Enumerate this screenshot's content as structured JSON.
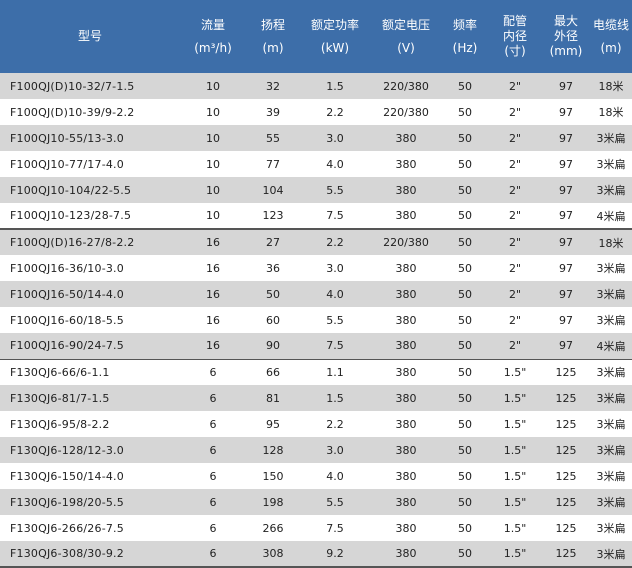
{
  "headers": [
    {
      "lines": [
        "型号"
      ],
      "unit": ""
    },
    {
      "lines": [
        "流量"
      ],
      "unit": "(m³/h)"
    },
    {
      "lines": [
        "扬程"
      ],
      "unit": "(m)"
    },
    {
      "lines": [
        "额定功率"
      ],
      "unit": "(kW)"
    },
    {
      "lines": [
        "额定电压"
      ],
      "unit": "(V)"
    },
    {
      "lines": [
        "频率"
      ],
      "unit": "(Hz)"
    },
    {
      "lines": [
        "配管",
        "内径",
        "(寸)"
      ],
      "unit": ""
    },
    {
      "lines": [
        "最大",
        "外径",
        "(mm)"
      ],
      "unit": ""
    },
    {
      "lines": [
        "电缆线"
      ],
      "unit": "(m)"
    }
  ],
  "rows": [
    [
      "F100QJ(D)10-32/7-1.5",
      "10",
      "32",
      "1.5",
      "220/380",
      "50",
      "2\"",
      "97",
      "18米"
    ],
    [
      "F100QJ(D)10-39/9-2.2",
      "10",
      "39",
      "2.2",
      "220/380",
      "50",
      "2\"",
      "97",
      "18米"
    ],
    [
      "F100QJ10-55/13-3.0",
      "10",
      "55",
      "3.0",
      "380",
      "50",
      "2\"",
      "97",
      "3米扁"
    ],
    [
      "F100QJ10-77/17-4.0",
      "10",
      "77",
      "4.0",
      "380",
      "50",
      "2\"",
      "97",
      "3米扁"
    ],
    [
      "F100QJ10-104/22-5.5",
      "10",
      "104",
      "5.5",
      "380",
      "50",
      "2\"",
      "97",
      "3米扁"
    ],
    [
      "F100QJ10-123/28-7.5",
      "10",
      "123",
      "7.5",
      "380",
      "50",
      "2\"",
      "97",
      "4米扁"
    ],
    [
      "F100QJ(D)16-27/8-2.2",
      "16",
      "27",
      "2.2",
      "220/380",
      "50",
      "2\"",
      "97",
      "18米"
    ],
    [
      "F100QJ16-36/10-3.0",
      "16",
      "36",
      "3.0",
      "380",
      "50",
      "2\"",
      "97",
      "3米扁"
    ],
    [
      "F100QJ16-50/14-4.0",
      "16",
      "50",
      "4.0",
      "380",
      "50",
      "2\"",
      "97",
      "3米扁"
    ],
    [
      "F100QJ16-60/18-5.5",
      "16",
      "60",
      "5.5",
      "380",
      "50",
      "2\"",
      "97",
      "3米扁"
    ],
    [
      "F100QJ16-90/24-7.5",
      "16",
      "90",
      "7.5",
      "380",
      "50",
      "2\"",
      "97",
      "4米扁"
    ],
    [
      "F130QJ6-66/6-1.1",
      "6",
      "66",
      "1.1",
      "380",
      "50",
      "1.5\"",
      "125",
      "3米扁"
    ],
    [
      "F130QJ6-81/7-1.5",
      "6",
      "81",
      "1.5",
      "380",
      "50",
      "1.5\"",
      "125",
      "3米扁"
    ],
    [
      "F130QJ6-95/8-2.2",
      "6",
      "95",
      "2.2",
      "380",
      "50",
      "1.5\"",
      "125",
      "3米扁"
    ],
    [
      "F130QJ6-128/12-3.0",
      "6",
      "128",
      "3.0",
      "380",
      "50",
      "1.5\"",
      "125",
      "3米扁"
    ],
    [
      "F130QJ6-150/14-4.0",
      "6",
      "150",
      "4.0",
      "380",
      "50",
      "1.5\"",
      "125",
      "3米扁"
    ],
    [
      "F130QJ6-198/20-5.5",
      "6",
      "198",
      "5.5",
      "380",
      "50",
      "1.5\"",
      "125",
      "3米扁"
    ],
    [
      "F130QJ6-266/26-7.5",
      "6",
      "266",
      "7.5",
      "380",
      "50",
      "1.5\"",
      "125",
      "3米扁"
    ],
    [
      "F130QJ6-308/30-9.2",
      "6",
      "308",
      "9.2",
      "380",
      "50",
      "1.5\"",
      "125",
      "3米扁"
    ]
  ],
  "colors": {
    "header_bg": "#3d6ea9",
    "stripe": "#d6d6d6",
    "divider": "#555555"
  }
}
